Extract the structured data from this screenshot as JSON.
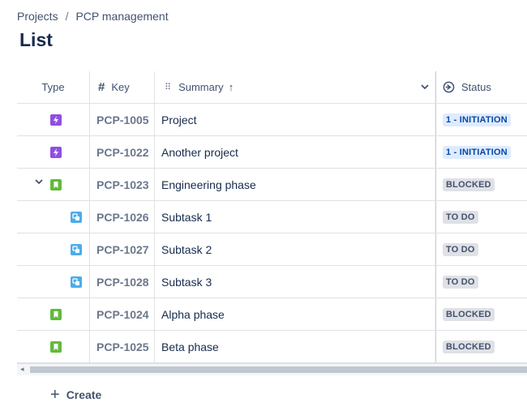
{
  "breadcrumb": {
    "items": [
      "Projects",
      "PCP management"
    ],
    "separator": "/"
  },
  "page": {
    "title": "List"
  },
  "table": {
    "headers": {
      "type": "Type",
      "key": "Key",
      "summary": "Summary",
      "status": "Status"
    },
    "rows": [
      {
        "icon": "epic-icon",
        "key": "PCP-1005",
        "summary": "Project",
        "status": "1 - INITIATION",
        "status_style": "blue",
        "indent": 0,
        "expander": false
      },
      {
        "icon": "epic-icon",
        "key": "PCP-1022",
        "summary": "Another project",
        "status": "1 - INITIATION",
        "status_style": "blue",
        "indent": 0,
        "expander": false
      },
      {
        "icon": "story-icon",
        "key": "PCP-1023",
        "summary": "Engineering phase",
        "status": "BLOCKED",
        "status_style": "grey",
        "indent": 0,
        "expander": true
      },
      {
        "icon": "subtask-icon",
        "key": "PCP-1026",
        "summary": "Subtask 1",
        "status": "TO DO",
        "status_style": "grey",
        "indent": 1,
        "expander": false
      },
      {
        "icon": "subtask-icon",
        "key": "PCP-1027",
        "summary": "Subtask 2",
        "status": "TO DO",
        "status_style": "grey",
        "indent": 1,
        "expander": false
      },
      {
        "icon": "subtask-icon",
        "key": "PCP-1028",
        "summary": "Subtask 3",
        "status": "TO DO",
        "status_style": "grey",
        "indent": 1,
        "expander": false
      },
      {
        "icon": "story-icon",
        "key": "PCP-1024",
        "summary": "Alpha phase",
        "status": "BLOCKED",
        "status_style": "grey",
        "indent": 0,
        "expander": false
      },
      {
        "icon": "story-icon",
        "key": "PCP-1025",
        "summary": "Beta phase",
        "status": "BLOCKED",
        "status_style": "grey",
        "indent": 0,
        "expander": false
      }
    ]
  },
  "create": {
    "label": "Create"
  },
  "colors": {
    "epic": "#904ee2",
    "story": "#63ba3c",
    "subtask": "#4bade8",
    "text": "#172b4d"
  }
}
